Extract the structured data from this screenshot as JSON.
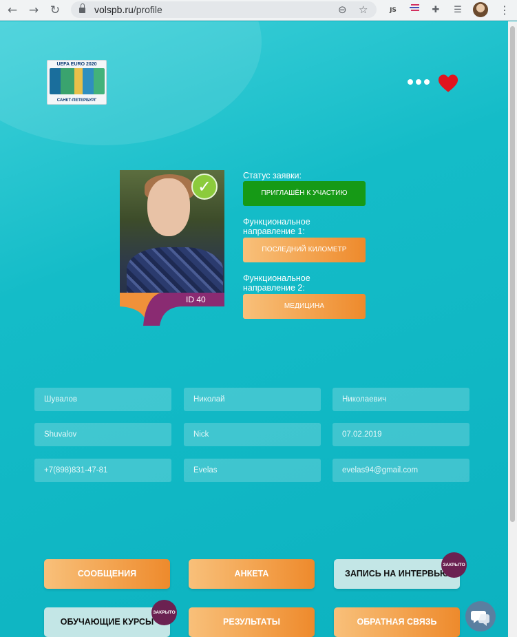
{
  "browser": {
    "url_host": "volspb.ru",
    "url_path": "/profile",
    "back_glyph": "←",
    "forward_glyph": "→",
    "reload_glyph": "↻",
    "zoom_glyph": "⊖",
    "star_glyph": "☆",
    "ext_js_label": "JS",
    "ext_puzzle_glyph": "✚",
    "ext_menu_glyph": "☰",
    "more_glyph": "⋮"
  },
  "logo": {
    "line1": "UEFA EURO 2020",
    "line2": "САНКТ-ПЕТЕРБУРГ"
  },
  "profile": {
    "id_label": "ID 40",
    "status_label": "Статус заявки:",
    "status_value": "ПРИГЛАШЁН К УЧАСТИЮ",
    "func1_label_line1": "Функциональное",
    "func1_label_line2": "направление 1:",
    "func1_value": "ПОСЛЕДНИЙ КИЛОМЕТР",
    "func2_label_line1": "Функциональное",
    "func2_label_line2": "направление 2:",
    "func2_value": "МЕДИЦИНА",
    "check_glyph": "✓"
  },
  "fields": {
    "last_name": "Шувалов",
    "first_name": "Николай",
    "middle_name": "Николаевич",
    "last_name_latin": "Shuvalov",
    "first_name_latin": "Nick",
    "date": "07.02.2019",
    "phone": "+7(898)831-47-81",
    "username": "Evelas",
    "email": "evelas94@gmail.com"
  },
  "buttons": {
    "messages": "СООБЩЕНИЯ",
    "questionnaire": "АНКЕТА",
    "interview": "ЗАПИСЬ НА ИНТЕРВЬЮ",
    "courses": "ОБУЧАЮЩИЕ КУРСЫ",
    "results": "РЕЗУЛЬТАТЫ",
    "feedback": "ОБРАТНАЯ СВЯЗЬ",
    "closed_badge": "ЗАКРЫТО"
  },
  "colors": {
    "page_bg": "#0fb8c4",
    "status_green": "#169a16",
    "orange_accent": "#ee8a2c",
    "closed_badge": "#6b2151",
    "heart": "#e0141e",
    "id_tab_purple": "#8a2b72"
  }
}
